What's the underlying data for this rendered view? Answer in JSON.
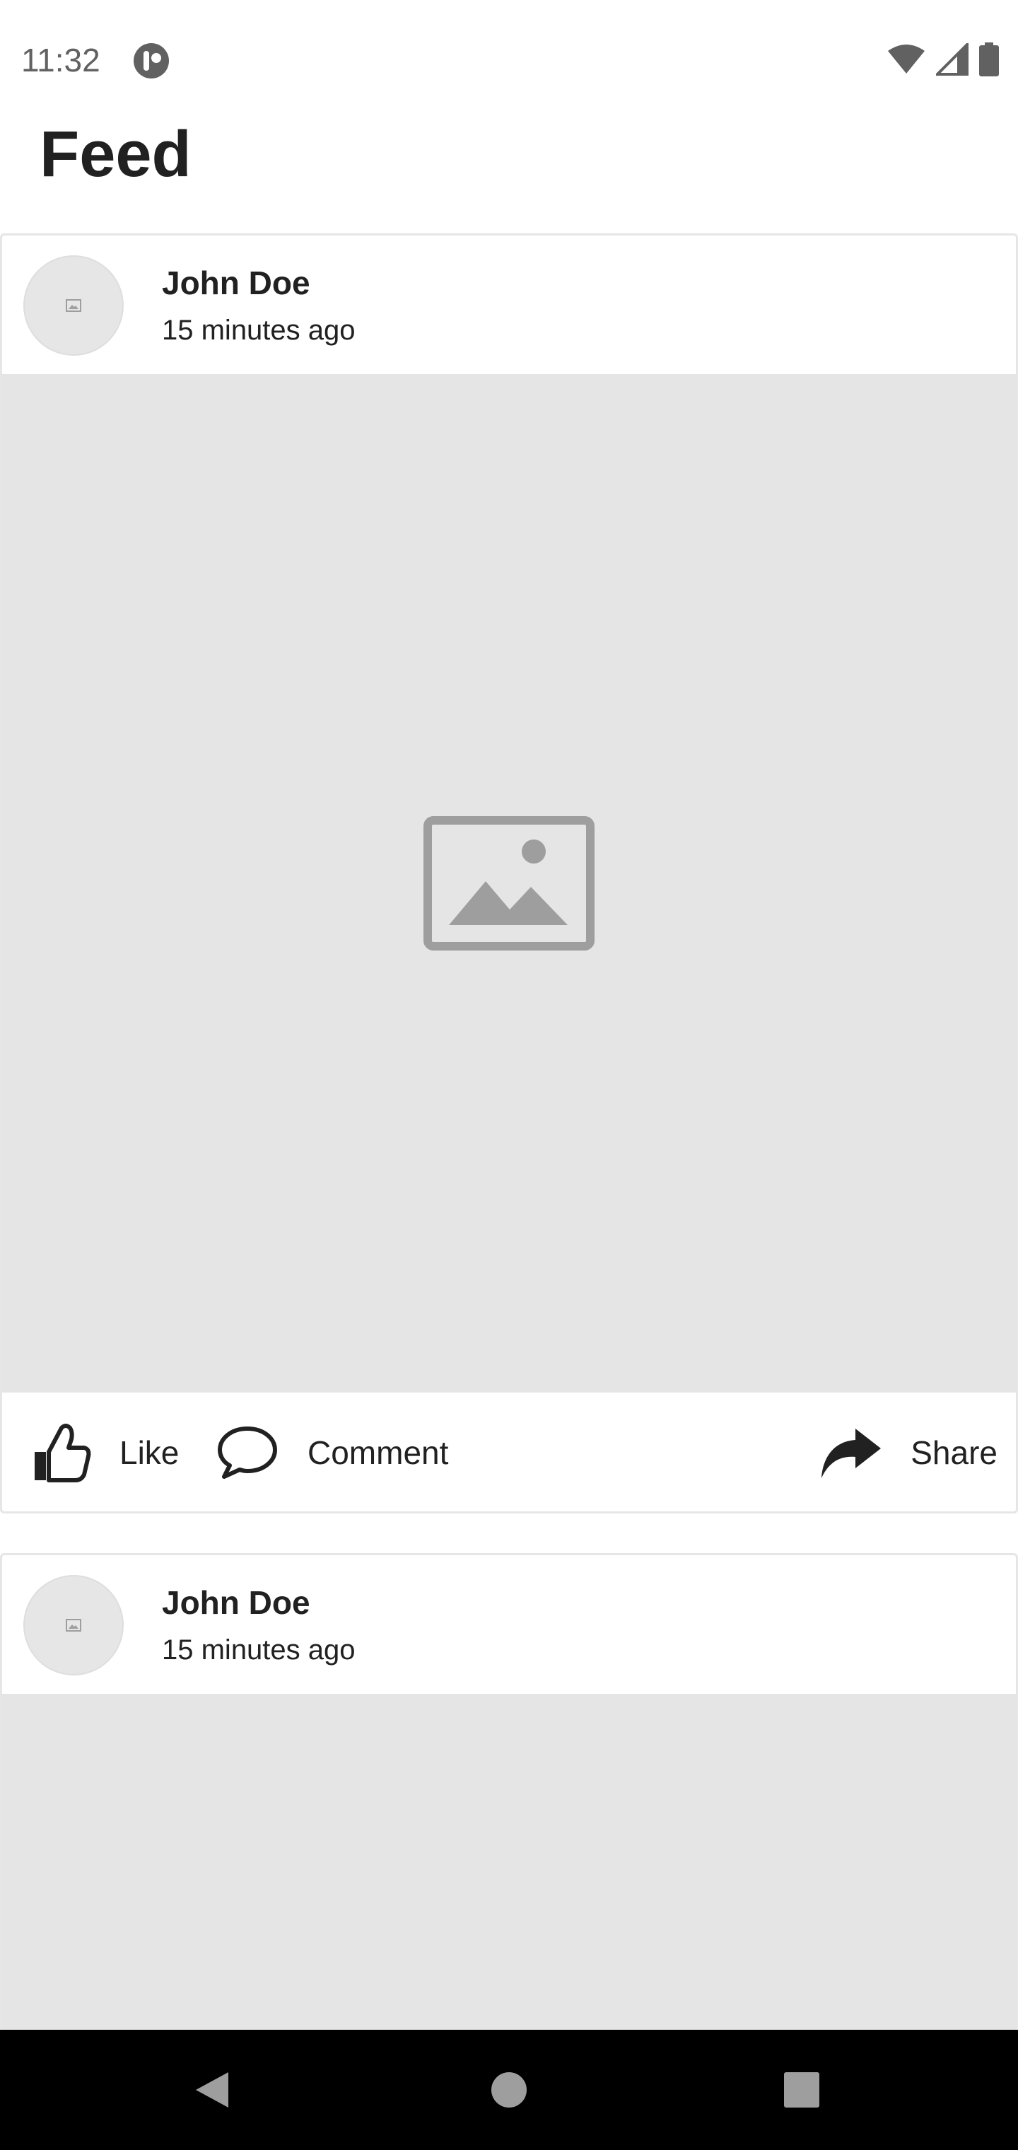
{
  "status_bar": {
    "time": "11:32",
    "icons": [
      "app-notification-icon",
      "wifi-icon",
      "cell-signal-icon",
      "battery-icon"
    ]
  },
  "header": {
    "title": "Feed"
  },
  "posts": [
    {
      "author": "John Doe",
      "timestamp": "15 minutes ago",
      "actions": {
        "like": "Like",
        "comment": "Comment",
        "share": "Share"
      }
    },
    {
      "author": "John Doe",
      "timestamp": "15 minutes ago"
    }
  ],
  "nav_bar": {
    "buttons": [
      "back-icon",
      "home-icon",
      "recents-icon"
    ]
  },
  "colors": {
    "placeholder_bg": "#e5e5e5",
    "placeholder_icon": "#9e9e9e",
    "text": "#212121",
    "nav_bg": "#000000"
  }
}
